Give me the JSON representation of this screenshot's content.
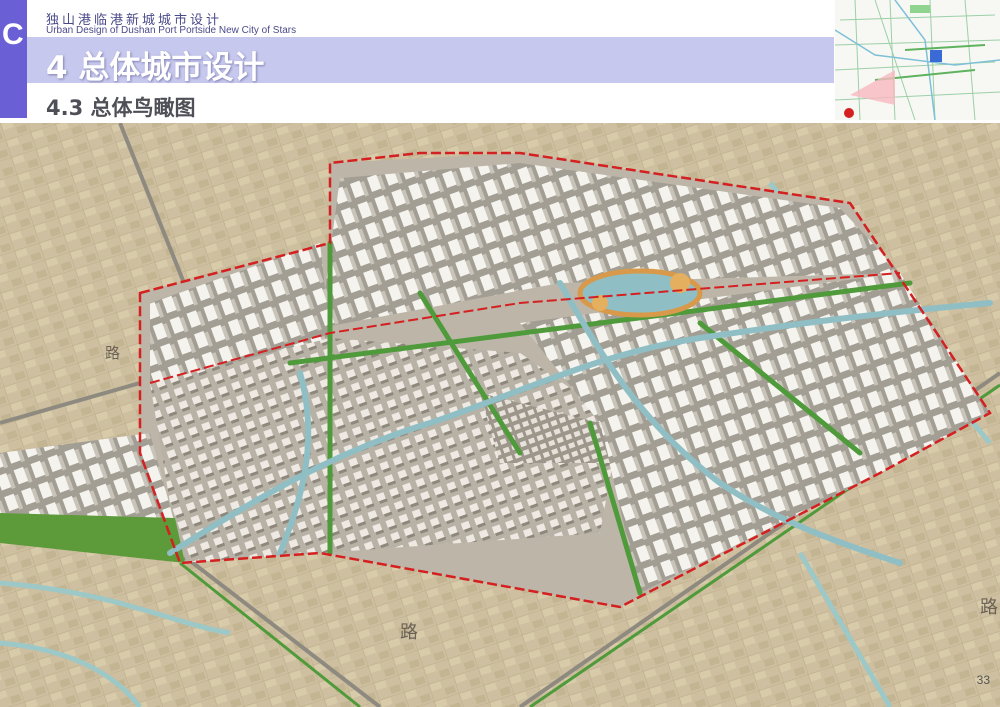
{
  "header": {
    "tab_letter": "C",
    "project_cn": "独山港临港新城城市设计",
    "project_en": "Urban Design of Dushan Port  Portside New City of Stars",
    "chapter_title": "4 总体城市设计",
    "section_title": "4.3 总体鸟瞰图"
  },
  "aerial": {
    "road_labels": [
      "路",
      "路",
      "路"
    ]
  },
  "footer": {
    "page_number": "33"
  },
  "colors": {
    "accent_purple": "#6b5fd6",
    "band_lavender": "#c7c8ee",
    "boundary_red": "#d42020",
    "canal_blue": "#8fbfc4"
  }
}
